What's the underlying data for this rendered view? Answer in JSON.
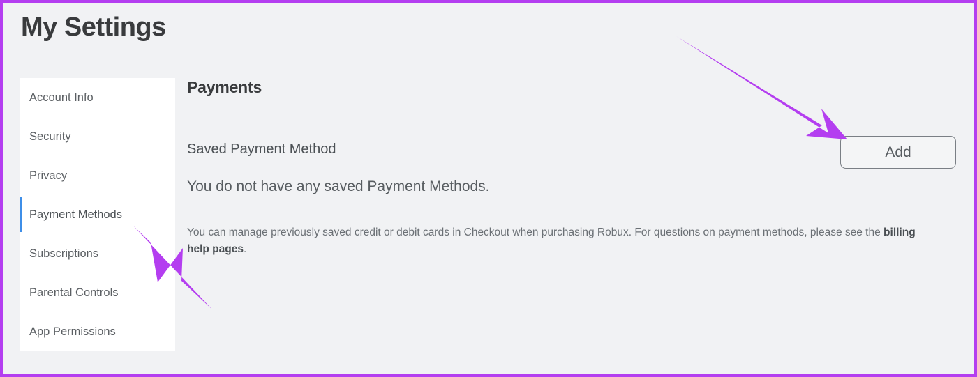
{
  "page": {
    "title": "My Settings"
  },
  "sidebar": {
    "items": [
      {
        "label": "Account Info",
        "active": false
      },
      {
        "label": "Security",
        "active": false
      },
      {
        "label": "Privacy",
        "active": false
      },
      {
        "label": "Payment Methods",
        "active": true
      },
      {
        "label": "Subscriptions",
        "active": false
      },
      {
        "label": "Parental Controls",
        "active": false
      },
      {
        "label": "App Permissions",
        "active": false
      }
    ]
  },
  "main": {
    "section_title": "Payments",
    "subsection_title": "Saved Payment Method",
    "add_button_label": "Add",
    "empty_state": "You do not have any saved Payment Methods.",
    "help_note_prefix": "You can manage previously saved credit or debit cards in Checkout when purchasing Robux. For questions on payment methods, please see the ",
    "help_note_link": "billing help pages",
    "help_note_suffix": "."
  },
  "annotations": {
    "arrow_to_add_button": "arrow-icon",
    "arrow_to_payment_methods": "arrow-icon"
  },
  "colors": {
    "accent_blue": "#3e8ee8",
    "annotation_purple": "#b43ef0",
    "page_background": "#f1f2f4",
    "card_background": "#ffffff",
    "text_dark": "#393b3d",
    "text_body": "#585d61",
    "text_muted": "#6b7075"
  }
}
